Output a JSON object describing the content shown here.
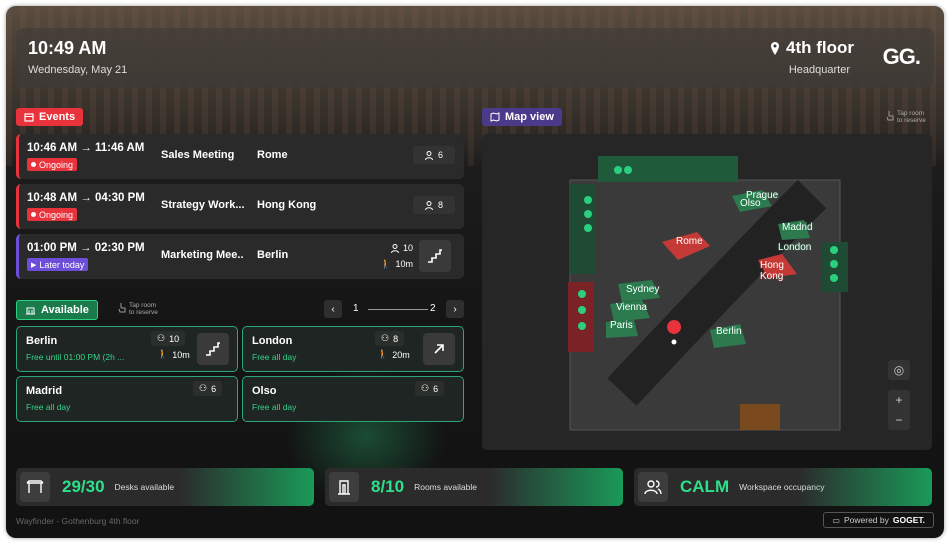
{
  "header": {
    "time": "10:49 AM",
    "date": "Wednesday, May 21",
    "floor": "4th floor",
    "building": "Headquarter",
    "logo": "GG."
  },
  "events_label": "Events",
  "map_label": "Map view",
  "tap_to_reserve": "Tap room to reserve",
  "events": [
    {
      "time": "10:46 AM → 11:46 AM",
      "status": "Ongoing",
      "name": "Sales Meeting",
      "room": "Rome",
      "capacity": "6"
    },
    {
      "time": "10:48 AM → 04:30 PM",
      "status": "Ongoing",
      "name": "Strategy Work...",
      "room": "Hong Kong",
      "capacity": "8"
    },
    {
      "time": "01:00 PM → 02:30 PM",
      "status": "Later today",
      "name": "Marketing Mee..",
      "room": "Berlin",
      "capacity": "10",
      "walk": "10m"
    }
  ],
  "available_label": "Available",
  "pagination": {
    "current": "1",
    "total": "2"
  },
  "available": [
    {
      "name": "Berlin",
      "status": "Free until 01:00 PM (2h ...",
      "capacity": "10",
      "walk": "10m"
    },
    {
      "name": "London",
      "status": "Free all day",
      "capacity": "8",
      "walk": "20m"
    },
    {
      "name": "Madrid",
      "status": "Free all day",
      "capacity": "6"
    },
    {
      "name": "Olso",
      "status": "Free all day",
      "capacity": "6"
    }
  ],
  "map_rooms": [
    "Prague",
    "Olso",
    "Madrid",
    "London",
    "Rome",
    "Hong Kong",
    "Sydney",
    "Vienna",
    "Paris",
    "Berlin"
  ],
  "stats": [
    {
      "value": "29/30",
      "label": "Desks available",
      "icon": "desk-icon"
    },
    {
      "value": "8/10",
      "label": "Rooms available",
      "icon": "room-door-icon"
    },
    {
      "value": "CALM",
      "label": "Workspace occupancy",
      "icon": "people-icon"
    }
  ],
  "footer": "Wayfinder - Gothenburg 4th floor",
  "powered": "Powered by",
  "powered_brand": "GOGET.",
  "colors": {
    "ongoing": "#e8323c",
    "later": "#6d4ed8",
    "available": "#2ad07f"
  }
}
